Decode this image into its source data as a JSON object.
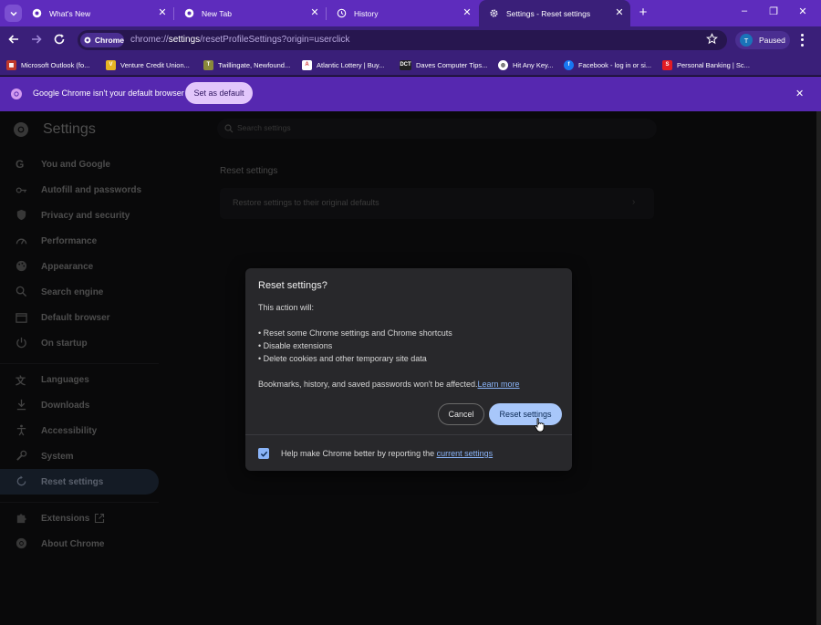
{
  "tabs": [
    {
      "title": "What's New",
      "icon": "chrome-icon"
    },
    {
      "title": "New Tab",
      "icon": "chrome-icon"
    },
    {
      "title": "History",
      "icon": "history-icon"
    },
    {
      "title": "Settings - Reset settings",
      "icon": "gear-icon"
    }
  ],
  "window_controls": {
    "minimize": "–",
    "restore": "❐",
    "close": "✕"
  },
  "toolbar": {
    "chip_label": "Chrome",
    "url_scheme": "chrome://",
    "url_host": "settings",
    "url_path": "/resetProfileSettings?origin=userclick",
    "profile_initial": "T",
    "profile_status": "Paused"
  },
  "bookmarks": [
    {
      "label": "Microsoft Outlook (fo...",
      "color": "#c0392b"
    },
    {
      "label": "Venture Credit Union...",
      "color": "#e6b422"
    },
    {
      "label": "Twillingate, Newfound...",
      "color": "#8a8a3a"
    },
    {
      "label": "Atlantic Lottery | Buy...",
      "color": "#d43a3a"
    },
    {
      "label": "Daves Computer Tips...",
      "color": "#222222"
    },
    {
      "label": "Hit Any Key...",
      "color": "#555555"
    },
    {
      "label": "Facebook - log in or si...",
      "color": "#1877f2"
    },
    {
      "label": "Personal Banking | Sc...",
      "color": "#e31b23"
    }
  ],
  "infobar": {
    "message": "Google Chrome isn't your default browser",
    "button": "Set as default"
  },
  "settings": {
    "title": "Settings",
    "search_placeholder": "Search settings",
    "nav": [
      {
        "label": "You and Google",
        "icon": "google-icon"
      },
      {
        "label": "Autofill and passwords",
        "icon": "key-icon"
      },
      {
        "label": "Privacy and security",
        "icon": "shield-icon"
      },
      {
        "label": "Performance",
        "icon": "speedometer-icon"
      },
      {
        "label": "Appearance",
        "icon": "palette-icon"
      },
      {
        "label": "Search engine",
        "icon": "search-icon"
      },
      {
        "label": "Default browser",
        "icon": "browser-icon"
      },
      {
        "label": "On startup",
        "icon": "power-icon"
      },
      {
        "label": "Languages",
        "icon": "translate-icon"
      },
      {
        "label": "Downloads",
        "icon": "download-icon"
      },
      {
        "label": "Accessibility",
        "icon": "accessibility-icon"
      },
      {
        "label": "System",
        "icon": "wrench-icon"
      },
      {
        "label": "Reset settings",
        "icon": "reset-icon"
      },
      {
        "label": "Extensions",
        "icon": "puzzle-icon"
      },
      {
        "label": "About Chrome",
        "icon": "chrome-icon"
      }
    ],
    "section_title": "Reset settings",
    "restore_row": "Restore settings to their original defaults"
  },
  "dialog": {
    "title": "Reset settings?",
    "intro": "This action will:",
    "bullets": [
      "• Reset some Chrome settings and Chrome shortcuts",
      "• Disable extensions",
      "• Delete cookies and other temporary site data"
    ],
    "note": "Bookmarks, history, and saved passwords won't be affected.",
    "learn_more": "Learn more",
    "cancel": "Cancel",
    "confirm": "Reset settings",
    "checkbox_label": "Help make Chrome better by reporting the ",
    "checkbox_link": "current settings",
    "checkbox_checked": true
  }
}
